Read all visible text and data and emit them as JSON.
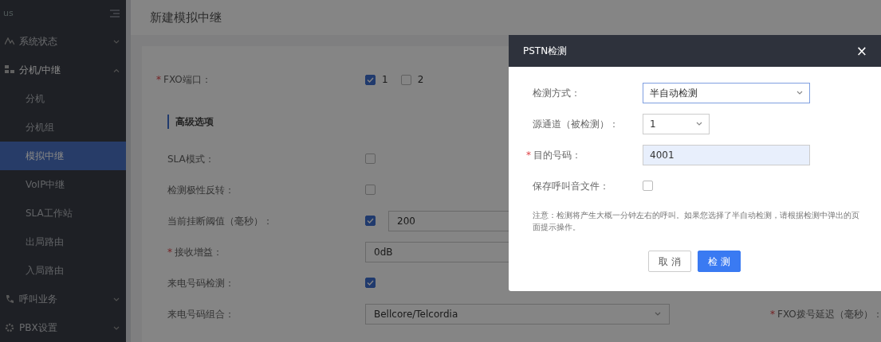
{
  "sidebar": {
    "brand": "us",
    "items": [
      {
        "label": "系统状态",
        "expanded": false
      },
      {
        "label": "分机/中继",
        "expanded": true,
        "children": [
          {
            "label": "分机",
            "selected": false
          },
          {
            "label": "分机组",
            "selected": false
          },
          {
            "label": "模拟中继",
            "selected": true
          },
          {
            "label": "VoIP中继",
            "selected": false
          },
          {
            "label": "SLA工作站",
            "selected": false
          },
          {
            "label": "出局路由",
            "selected": false
          },
          {
            "label": "入局路由",
            "selected": false
          }
        ]
      },
      {
        "label": "呼叫业务",
        "expanded": false
      },
      {
        "label": "PBX设置",
        "expanded": false
      }
    ]
  },
  "page_title": "新建模拟中继",
  "form": {
    "fxo_port": {
      "label": "FXO端口：",
      "marker": "*",
      "options": [
        {
          "label": "1",
          "checked": true
        },
        {
          "label": "2",
          "checked": false
        }
      ]
    },
    "section": "高级选项",
    "rows": [
      {
        "kind": "checkbox",
        "label": "SLA模式：",
        "checked": false
      },
      {
        "kind": "checkbox",
        "label": "检测极性反转：",
        "checked": false
      },
      {
        "kind": "checkinput",
        "label": "当前挂断阈值（毫秒）：",
        "checked": true,
        "value": "200"
      },
      {
        "kind": "input",
        "label": "接收增益：",
        "marker": "*",
        "value": "0dB"
      },
      {
        "kind": "checkbox",
        "label": "来电号码检测：",
        "checked": true
      },
      {
        "kind": "select",
        "label": "来电号码组合：",
        "value": "Bellcore/Telcordia",
        "side_label": "FXO拨号延迟（毫秒）：",
        "side_marker": "*"
      }
    ]
  },
  "dialog": {
    "title": "PSTN检测",
    "close": "×",
    "fields": [
      {
        "kind": "select",
        "label": "检测方式：",
        "value": "半自动检测",
        "focused": true
      },
      {
        "kind": "select_small",
        "label": "源通道（被检测）：",
        "value": "1",
        "focused": false
      },
      {
        "kind": "input",
        "label": "目的号码：",
        "marker": "*",
        "value": "4001",
        "focused": false
      },
      {
        "kind": "checkbox",
        "label": "保存呼叫音文件：",
        "checked": false
      }
    ],
    "note": "注意：检测将产生大概一分钟左右的呼叫。如果您选择了半自动检测，请根据检测中弹出的页面提示操作。",
    "buttons": [
      {
        "label": "取 消",
        "primary": false
      },
      {
        "label": "检 测",
        "primary": true
      }
    ]
  }
}
